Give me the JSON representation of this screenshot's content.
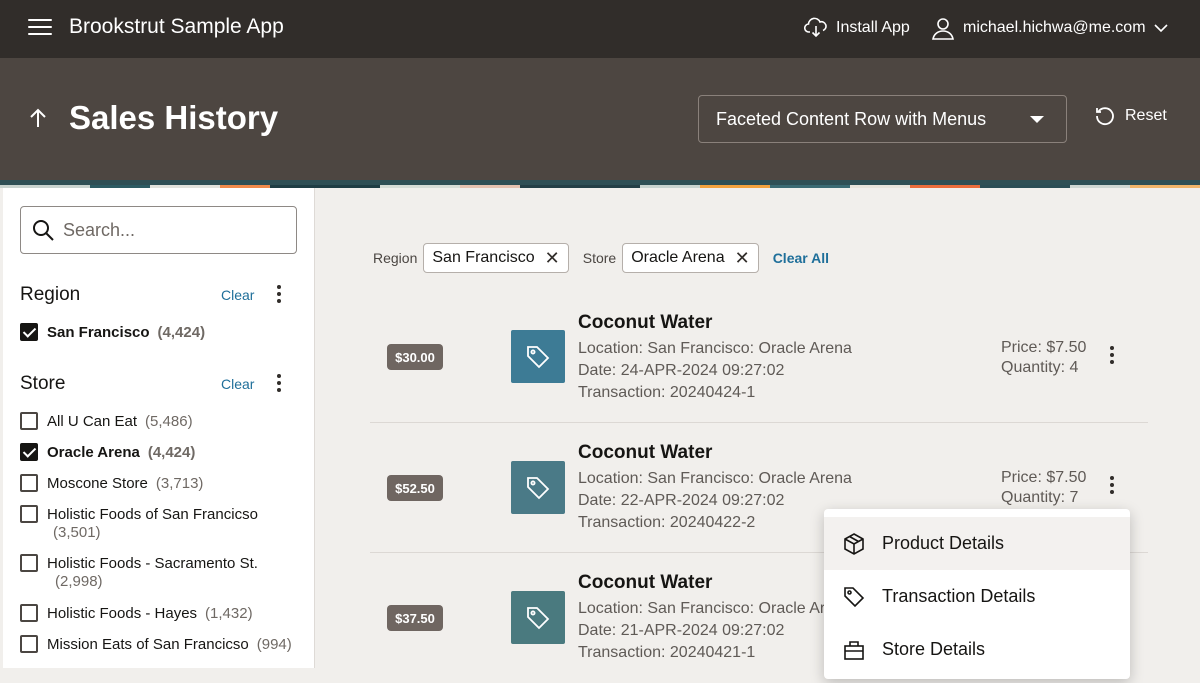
{
  "topbar": {
    "app_title": "Brookstrut Sample App",
    "install_label": "Install App",
    "user_email": "michael.hichwa@me.com"
  },
  "header": {
    "title": "Sales History",
    "view_select_value": "Faceted Content Row with Menus",
    "reset_label": "Reset"
  },
  "sidebar": {
    "search_placeholder": "Search...",
    "facets": [
      {
        "title": "Region",
        "clear_label": "Clear",
        "options": [
          {
            "label": "San Francisco",
            "count": "(4,424)",
            "checked": true
          }
        ]
      },
      {
        "title": "Store",
        "clear_label": "Clear",
        "options": [
          {
            "label": "All U Can Eat",
            "count": "(5,486)",
            "checked": false
          },
          {
            "label": "Oracle Arena",
            "count": "(4,424)",
            "checked": true
          },
          {
            "label": "Moscone Store",
            "count": "(3,713)",
            "checked": false
          },
          {
            "label": "Holistic Foods of San Francicso",
            "count": "(3,501)",
            "checked": false
          },
          {
            "label": "Holistic Foods - Sacramento St.",
            "count": "(2,998)",
            "checked": false
          },
          {
            "label": "Holistic Foods - Hayes",
            "count": "(1,432)",
            "checked": false
          },
          {
            "label": "Mission Eats of San Francicso",
            "count": "(994)",
            "checked": false
          }
        ]
      }
    ]
  },
  "filters": {
    "chips": [
      {
        "label": "Region",
        "value": "San Francisco"
      },
      {
        "label": "Store",
        "value": "Oracle Arena"
      }
    ],
    "clear_all_label": "Clear All"
  },
  "results": [
    {
      "badge": "$30.00",
      "tile_color": "#3d7b95",
      "title": "Coconut Water",
      "location": "Location: San Francisco: Oracle Arena",
      "date": "Date: 24-APR-2024 09:27:02",
      "transaction": "Transaction: 20240424-1",
      "price": "Price: $7.50",
      "quantity": "Quantity: 4"
    },
    {
      "badge": "$52.50",
      "tile_color": "#4a7a87",
      "title": "Coconut Water",
      "location": "Location: San Francisco: Oracle Arena",
      "date": "Date: 22-APR-2024 09:27:02",
      "transaction": "Transaction: 20240422-2",
      "price": "Price: $7.50",
      "quantity": "Quantity: 7"
    },
    {
      "badge": "$37.50",
      "tile_color": "#4a7a7f",
      "title": "Coconut Water",
      "location": "Location: San Francisco: Oracle Arena",
      "date": "Date: 21-APR-2024 09:27:02",
      "transaction": "Transaction: 20240421-1"
    }
  ],
  "row_menu": {
    "items": [
      {
        "label": "Product Details",
        "icon": "box-icon"
      },
      {
        "label": "Transaction Details",
        "icon": "tag-icon"
      },
      {
        "label": "Store Details",
        "icon": "store-icon"
      }
    ]
  }
}
